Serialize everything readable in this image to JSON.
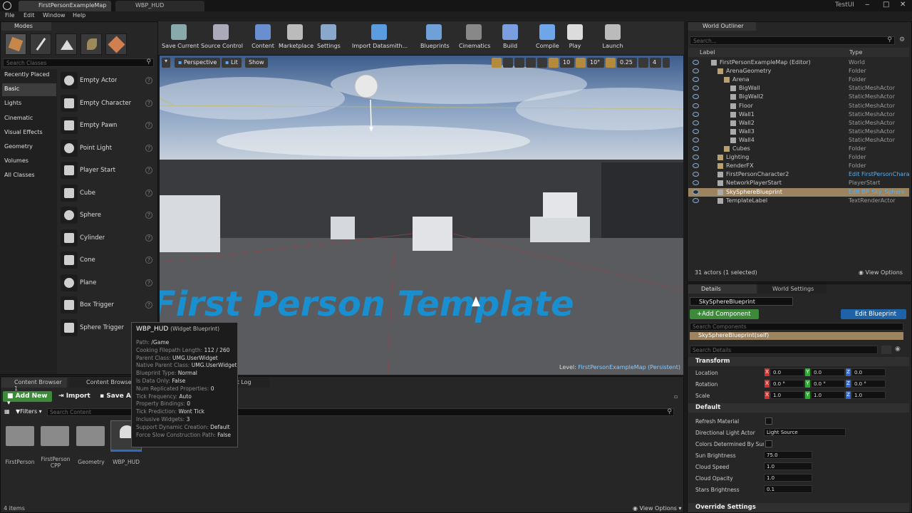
{
  "title_bar": {
    "tabs": [
      "FirstPersonExampleMap",
      "WBP_HUD"
    ],
    "project": "TestUI"
  },
  "menu": [
    "File",
    "Edit",
    "Window",
    "Help"
  ],
  "modes": {
    "tab": "Modes",
    "search_placeholder": "Search Classes",
    "categories": [
      "Recently Placed",
      "Basic",
      "Lights",
      "Cinematic",
      "Visual Effects",
      "Geometry",
      "Volumes",
      "All Classes"
    ],
    "selected_category": "Basic",
    "items": [
      "Empty Actor",
      "Empty Character",
      "Empty Pawn",
      "Point Light",
      "Player Start",
      "Cube",
      "Sphere",
      "Cylinder",
      "Cone",
      "Plane",
      "Box Trigger",
      "Sphere Trigger"
    ]
  },
  "toolbar": [
    {
      "label": "Save Current",
      "icon": "save-icon"
    },
    {
      "label": "Source Control",
      "icon": "source-control-icon"
    },
    {
      "label": "Content",
      "icon": "content-icon"
    },
    {
      "label": "Marketplace",
      "icon": "marketplace-icon"
    },
    {
      "label": "Settings",
      "icon": "settings-icon"
    },
    {
      "label": "Import Datasmith...",
      "icon": "datasmith-icon"
    },
    {
      "label": "Blueprints",
      "icon": "blueprints-icon"
    },
    {
      "label": "Cinematics",
      "icon": "cinematics-icon"
    },
    {
      "label": "Build",
      "icon": "build-icon"
    },
    {
      "label": "Compile",
      "icon": "compile-icon"
    },
    {
      "label": "Play",
      "icon": "play-icon"
    },
    {
      "label": "Launch",
      "icon": "launch-icon"
    }
  ],
  "viewport": {
    "perspective": "Perspective",
    "lit": "Lit",
    "show": "Show",
    "grid_snap": "10",
    "rot_snap": "10°",
    "scale_snap": "0.25",
    "cam_speed": "4",
    "level_label": "Level:",
    "level_name": "FirstPersonExampleMap (Persistent)",
    "floor_text": "First Person Template"
  },
  "outliner": {
    "tab": "World Outliner",
    "search_placeholder": "Search...",
    "col_label": "Label",
    "col_type": "Type",
    "rows": [
      {
        "label": "FirstPersonExampleMap (Editor)",
        "type": "World",
        "indent": 0
      },
      {
        "label": "ArenaGeometry",
        "type": "Folder",
        "indent": 1
      },
      {
        "label": "Arena",
        "type": "Folder",
        "indent": 2
      },
      {
        "label": "BigWall",
        "type": "StaticMeshActor",
        "indent": 3
      },
      {
        "label": "BigWall2",
        "type": "StaticMeshActor",
        "indent": 3
      },
      {
        "label": "Floor",
        "type": "StaticMeshActor",
        "indent": 3
      },
      {
        "label": "Wall1",
        "type": "StaticMeshActor",
        "indent": 3
      },
      {
        "label": "Wall2",
        "type": "StaticMeshActor",
        "indent": 3
      },
      {
        "label": "Wall3",
        "type": "StaticMeshActor",
        "indent": 3
      },
      {
        "label": "Wall4",
        "type": "StaticMeshActor",
        "indent": 3
      },
      {
        "label": "Cubes",
        "type": "Folder",
        "indent": 2
      },
      {
        "label": "Lighting",
        "type": "Folder",
        "indent": 1
      },
      {
        "label": "RenderFX",
        "type": "Folder",
        "indent": 1
      },
      {
        "label": "FirstPersonCharacter2",
        "type": "Edit FirstPersonChara",
        "indent": 1
      },
      {
        "label": "NetworkPlayerStart",
        "type": "PlayerStart",
        "indent": 1
      },
      {
        "label": "SkySphereBlueprint",
        "type": "Edit BP_Sky_Sphere",
        "indent": 1,
        "selected": true
      },
      {
        "label": "TemplateLabel",
        "type": "TextRenderActor",
        "indent": 1
      }
    ],
    "status": "31 actors (1 selected)",
    "view_options": "View Options"
  },
  "details": {
    "tabs": [
      "Details",
      "World Settings"
    ],
    "name": "SkySphereBlueprint",
    "add_component": "+Add Component",
    "edit_blueprint": "Edit Blueprint",
    "search_components": "Search Components",
    "self": "SkySphereBlueprint(self)",
    "search_details": "Search Details",
    "transform": "Transform",
    "location": "Location",
    "rotation": "Rotation",
    "scale": "Scale",
    "loc": [
      "0.0",
      "0.0",
      "0.0"
    ],
    "rot": [
      "0.0 °",
      "0.0 °",
      "0.0 °"
    ],
    "scl": [
      "1.0",
      "1.0",
      "1.0"
    ],
    "default": "Default",
    "props": [
      {
        "label": "Refresh Material",
        "value": ""
      },
      {
        "label": "Directional Light Actor",
        "value": "Light Source"
      },
      {
        "label": "Colors Determined By Sun P.",
        "value": ""
      },
      {
        "label": "Sun Brightness",
        "value": "75.0"
      },
      {
        "label": "Cloud Speed",
        "value": "1.0"
      },
      {
        "label": "Cloud Opacity",
        "value": "1.0"
      },
      {
        "label": "Stars Brightness",
        "value": "0.1"
      }
    ],
    "override": "Override Settings"
  },
  "content_browser": {
    "tabs": [
      "Content Browser 1",
      "Content Browser",
      "Output Log"
    ],
    "add_new": "Add New",
    "import": "Import",
    "save_all": "Save A",
    "filters": "Filters",
    "search_placeholder": "Search Content",
    "assets": [
      "FirstPerson",
      "FirstPerson CPP",
      "Geometry",
      "WBP_HUD"
    ],
    "status": "4 items",
    "view_options": "View Options"
  },
  "tooltip": {
    "title": "WBP_HUD",
    "subtitle": "(Widget Blueprint)",
    "rows": [
      [
        "Path:",
        "/Game"
      ],
      [
        "Cooking Filepath Length:",
        "112 / 260"
      ],
      [
        "Parent Class:",
        "UMG.UserWidget"
      ],
      [
        "Native Parent Class:",
        "UMG.UserWidget"
      ],
      [
        "Blueprint Type:",
        "Normal"
      ],
      [
        "Is Data Only:",
        "False"
      ],
      [
        "Num Replicated Properties:",
        "0"
      ],
      [
        "Tick Frequency:",
        "Auto"
      ],
      [
        "Property Bindings:",
        "0"
      ],
      [
        "Tick Prediction:",
        "Wont Tick"
      ],
      [
        "Inclusive Widgets:",
        "3"
      ],
      [
        "Support Dynamic Creation:",
        "Default"
      ],
      [
        "Force Slow Construction Path:",
        "False"
      ]
    ]
  }
}
